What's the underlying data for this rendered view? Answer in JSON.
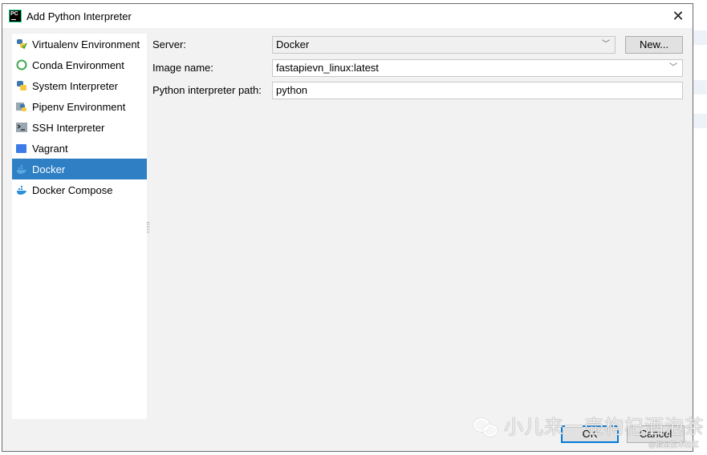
{
  "dialog": {
    "title": "Add Python Interpreter",
    "close_icon": "close-icon"
  },
  "sidebar": {
    "items": [
      {
        "label": "Virtualenv Environment",
        "icon": "python-virtualenv-icon",
        "selected": false
      },
      {
        "label": "Conda Environment",
        "icon": "conda-ring-icon",
        "selected": false
      },
      {
        "label": "System Interpreter",
        "icon": "python-icon",
        "selected": false
      },
      {
        "label": "Pipenv Environment",
        "icon": "pipenv-icon",
        "selected": false
      },
      {
        "label": "SSH Interpreter",
        "icon": "terminal-icon",
        "selected": false
      },
      {
        "label": "Vagrant",
        "icon": "vagrant-icon",
        "selected": false
      },
      {
        "label": "Docker",
        "icon": "docker-icon",
        "selected": true
      },
      {
        "label": "Docker Compose",
        "icon": "docker-compose-icon",
        "selected": false
      }
    ]
  },
  "form": {
    "server_label": "Server:",
    "server_value": "Docker",
    "new_button": "New...",
    "image_label": "Image name:",
    "image_value": "fastapievn_linux:latest",
    "path_label": "Python interpreter path:",
    "path_value": "python"
  },
  "footer": {
    "ok": "OK",
    "cancel": "Cancel"
  },
  "watermark": {
    "text": "小儿来一壶枸杞酒泡茶",
    "source": "@掘金技术社区"
  },
  "colors": {
    "selection": "#2f7fc4",
    "ok_border": "#0078d7"
  }
}
